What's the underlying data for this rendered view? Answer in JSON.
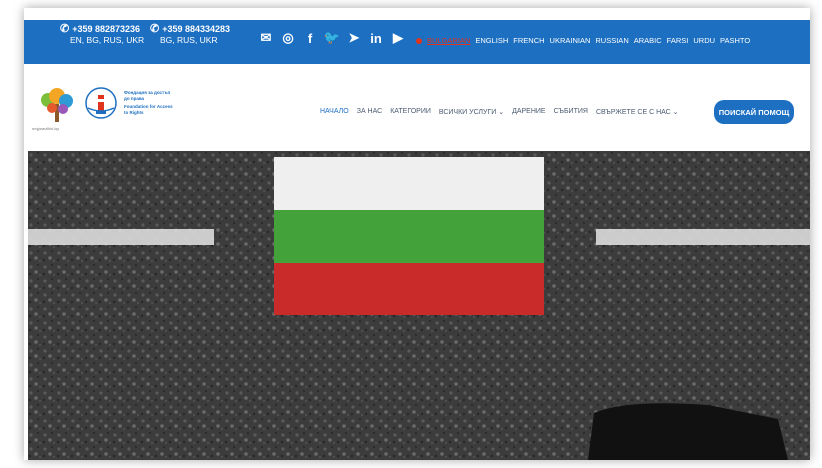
{
  "topbar": {
    "phone1": {
      "number": "+359 882873236",
      "langs": "EN, BG, RUS, UKR"
    },
    "phone2": {
      "number": "+359 884334283",
      "langs": "BG, RUS, UKR"
    },
    "social_icons": [
      "envelope-icon",
      "instagram-icon",
      "facebook-icon",
      "twitter-icon",
      "telegram-icon",
      "linkedin-icon",
      "youtube-icon"
    ],
    "languages": [
      "BULGARIAN",
      "ENGLISH",
      "FRENCH",
      "UKRAINIAN",
      "RUSSIAN",
      "ARABIC",
      "FARSI",
      "URDU",
      "PASHTO"
    ],
    "active_language": "BULGARIAN"
  },
  "header": {
    "logo_caption": "mojpravilkhi.bg",
    "logo2_text_bg": "Фондация за достъп до права",
    "logo2_text_en": "Foundation for Access to Rights",
    "nav": [
      "НАЧАЛО",
      "ЗА НАС",
      "КАТЕГОРИИ",
      "ВСИЧКИ УСЛУГИ ⌄",
      "ДАРЕНИЕ",
      "СЪБИТИЯ",
      "СВЪРЖЕТЕ СЕ С НАС ⌄"
    ],
    "cta_label": "ПОИСКАЙ ПОМОЩ"
  },
  "colors": {
    "brand_blue": "#1d6fc2",
    "flag_white": "#efefef",
    "flag_green": "#43a33a",
    "flag_red": "#c92b2b",
    "asphalt": "#3f3f3f"
  }
}
